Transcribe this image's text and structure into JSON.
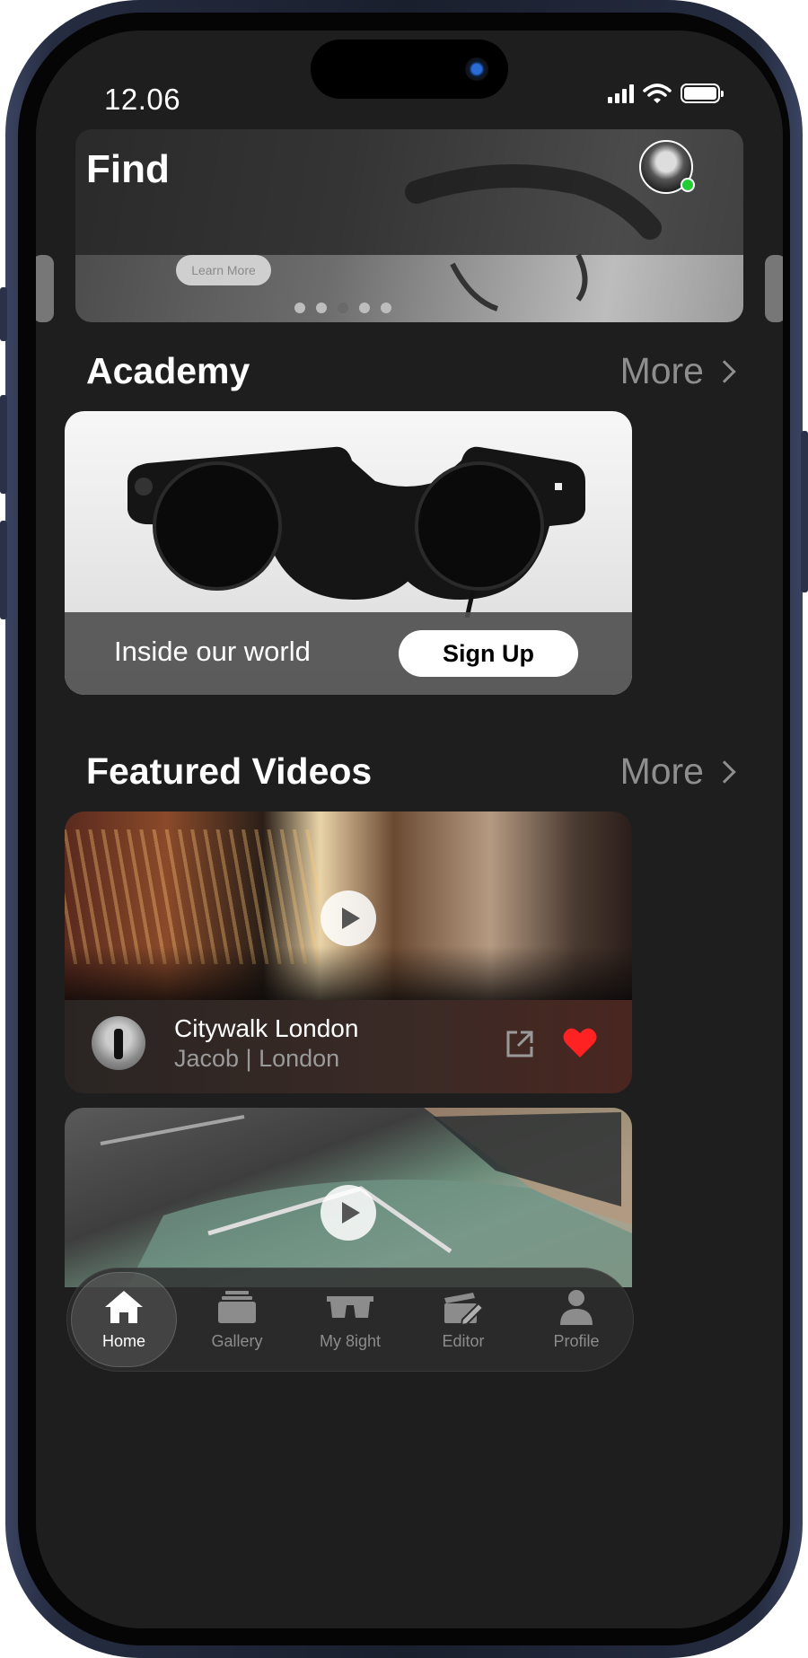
{
  "status": {
    "time": "12.06"
  },
  "header": {
    "title": "Find"
  },
  "banner": {
    "learn_more": "Learn More"
  },
  "academy": {
    "title": "Academy",
    "more": "More",
    "caption": "Inside our world",
    "signup": "Sign Up"
  },
  "featured": {
    "title": "Featured Videos",
    "more": "More",
    "videos": [
      {
        "title": "Citywalk London",
        "subtitle": "Jacob | London",
        "liked": true
      }
    ]
  },
  "tabs": [
    {
      "label": "Home",
      "icon": "home-icon",
      "active": true
    },
    {
      "label": "Gallery",
      "icon": "gallery-icon",
      "active": false
    },
    {
      "label": "My 8ight",
      "icon": "glasses-icon",
      "active": false
    },
    {
      "label": "Editor",
      "icon": "editor-icon",
      "active": false
    },
    {
      "label": "Profile",
      "icon": "profile-icon",
      "active": false
    }
  ],
  "colors": {
    "background": "#1e1e1e",
    "heart": "#ff2222",
    "online": "#22cc33",
    "muted": "#8e8e8e"
  }
}
